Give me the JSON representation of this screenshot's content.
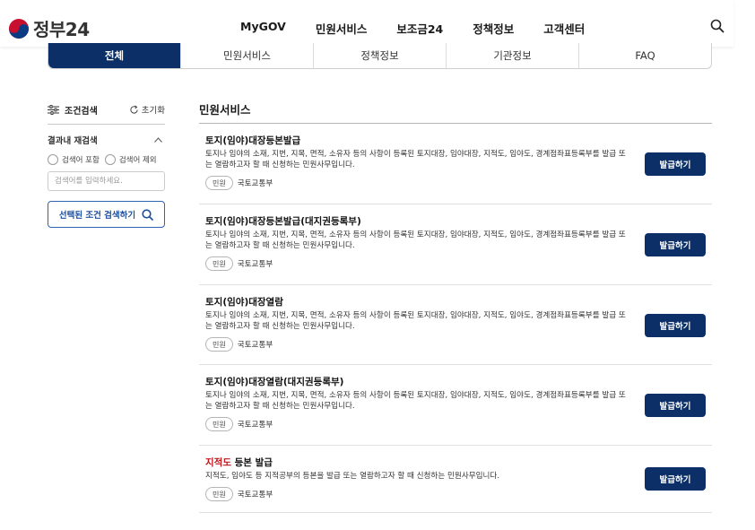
{
  "header": {
    "logo_text": "정부24",
    "nav": [
      "MyGOV",
      "민원서비스",
      "보조금24",
      "정책정보",
      "고객센터"
    ]
  },
  "tabs": [
    {
      "label": "전체",
      "active": true
    },
    {
      "label": "민원서비스",
      "active": false
    },
    {
      "label": "정책정보",
      "active": false
    },
    {
      "label": "기관정보",
      "active": false
    },
    {
      "label": "FAQ",
      "active": false
    }
  ],
  "sidebar": {
    "title": "조건검색",
    "reset_label": "초기화",
    "subsection": "결과내 재검색",
    "radio_include": "검색어 포함",
    "radio_exclude": "검색어 제외",
    "input_placeholder": "검색어를 입력하세요.",
    "search_button": "선택된 조건 검색하기"
  },
  "main": {
    "section_title": "민원서비스",
    "items": [
      {
        "title_highlight": "",
        "title": "토지(임야)대장등본발급",
        "desc": "토지나 임야의 소재, 지번, 지목, 면적, 소유자 등의 사항이 등록된 토지대장, 임야대장, 지적도, 임야도, 경계점좌표등록부를 발급 또는 열람하고자 할 때 신청하는 민원사무입니다.",
        "tag": "민원",
        "org": "국토교통부",
        "button": "발급하기"
      },
      {
        "title_highlight": "",
        "title": "토지(임야)대장등본발급(대지권등록부)",
        "desc": "토지나 임야의 소재, 지번, 지목, 면적, 소유자 등의 사항이 등록된 토지대장, 임야대장, 지적도, 임야도, 경계점좌표등록부를 발급 또는 열람하고자 할 때 신청하는 민원사무입니다.",
        "tag": "민원",
        "org": "국토교통부",
        "button": "발급하기"
      },
      {
        "title_highlight": "",
        "title": "토지(임야)대장열람",
        "desc": "토지나 임야의 소재, 지번, 지목, 면적, 소유자 등의 사항이 등록된 토지대장, 임야대장, 지적도, 임야도, 경계점좌표등록부를 발급 또는 열람하고자 할 때 신청하는 민원사무입니다.",
        "tag": "민원",
        "org": "국토교통부",
        "button": "발급하기"
      },
      {
        "title_highlight": "",
        "title": "토지(임야)대장열람(대지권등록부)",
        "desc": "토지나 임야의 소재, 지번, 지목, 면적, 소유자 등의 사항이 등록된 토지대장, 임야대장, 지적도, 임야도, 경계점좌표등록부를 발급 또는 열람하고자 할 때 신청하는 민원사무입니다.",
        "tag": "민원",
        "org": "국토교통부",
        "button": "발급하기"
      },
      {
        "title_highlight": "지적도",
        "title": " 등본 발급",
        "desc": "지적도, 임야도 등 지적공부의 등본을 발급 또는 열람하고자 할 때 신청하는 민원사무입니다.",
        "tag": "민원",
        "org": "국토교통부",
        "button": "발급하기"
      }
    ]
  }
}
